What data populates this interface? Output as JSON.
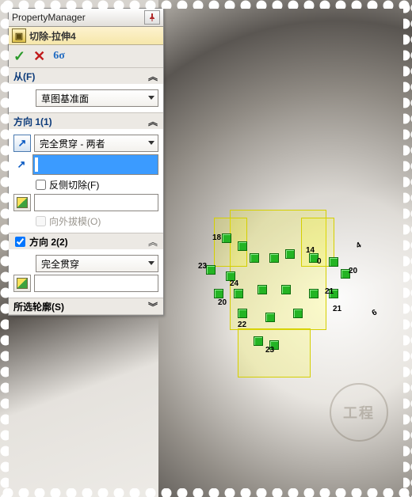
{
  "pm": {
    "title": "PropertyManager"
  },
  "feature": {
    "title": "切除-拉伸4"
  },
  "from": {
    "heading": "从(F)",
    "plane": "草图基准面"
  },
  "dir1": {
    "heading": "方向 1(1)",
    "end_condition": "完全贯穿 - 两者",
    "flip_label": "反侧切除(F)",
    "draft_label": "向外拔模(O)"
  },
  "dir2": {
    "heading": "方向 2(2)",
    "end_condition": "完全贯穿"
  },
  "contours": {
    "heading": "所选轮廓(S)"
  },
  "icons": {
    "ok": "✓",
    "cancel": "✕",
    "preview": "6σ",
    "chev_up": "︽",
    "chev_down": "︾",
    "arrow_ne": "↗",
    "arrow_e": "↗"
  },
  "dims": {
    "d0": "0",
    "d4": "4",
    "d6": "6",
    "d14": "14",
    "d18": "18",
    "d20": "20",
    "d21": "21",
    "d22": "22",
    "d23": "23",
    "d24": "24"
  },
  "watermark": "工程"
}
